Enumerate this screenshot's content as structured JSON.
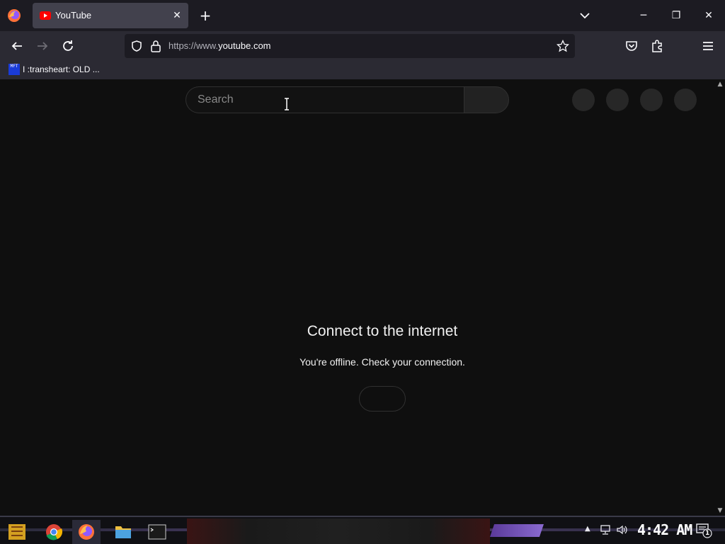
{
  "browser": {
    "tab": {
      "title": "YouTube"
    },
    "url": {
      "prefix": "https://www.",
      "domain": "youtube.com"
    },
    "bookmark": {
      "label": "I :transheart: OLD ...",
      "icon_text": "MFT"
    },
    "window_controls": {
      "minimize": "─",
      "restore": "❐",
      "close": "✕"
    },
    "new_tab": "+",
    "tab_close": "✕"
  },
  "page": {
    "search": {
      "placeholder": "Search"
    },
    "offline": {
      "title": "Connect to the internet",
      "message": "You're offline. Check your connection."
    }
  },
  "taskbar": {
    "clock": "4:42 AM",
    "notification_count": "1"
  },
  "colors": {
    "page_bg": "#0f0f0f",
    "browser_chrome": "#2b2a33",
    "tab_active": "#42414d",
    "youtube_red": "#ff0000"
  },
  "icons": [
    "firefox-icon",
    "youtube-favicon",
    "back-icon",
    "forward-icon",
    "reload-icon",
    "shield-icon",
    "lock-icon",
    "star-icon",
    "pocket-icon",
    "extensions-icon",
    "menu-icon",
    "chrome-icon",
    "file-explorer-icon",
    "terminal-icon",
    "network-icon",
    "volume-icon",
    "action-center-icon"
  ]
}
